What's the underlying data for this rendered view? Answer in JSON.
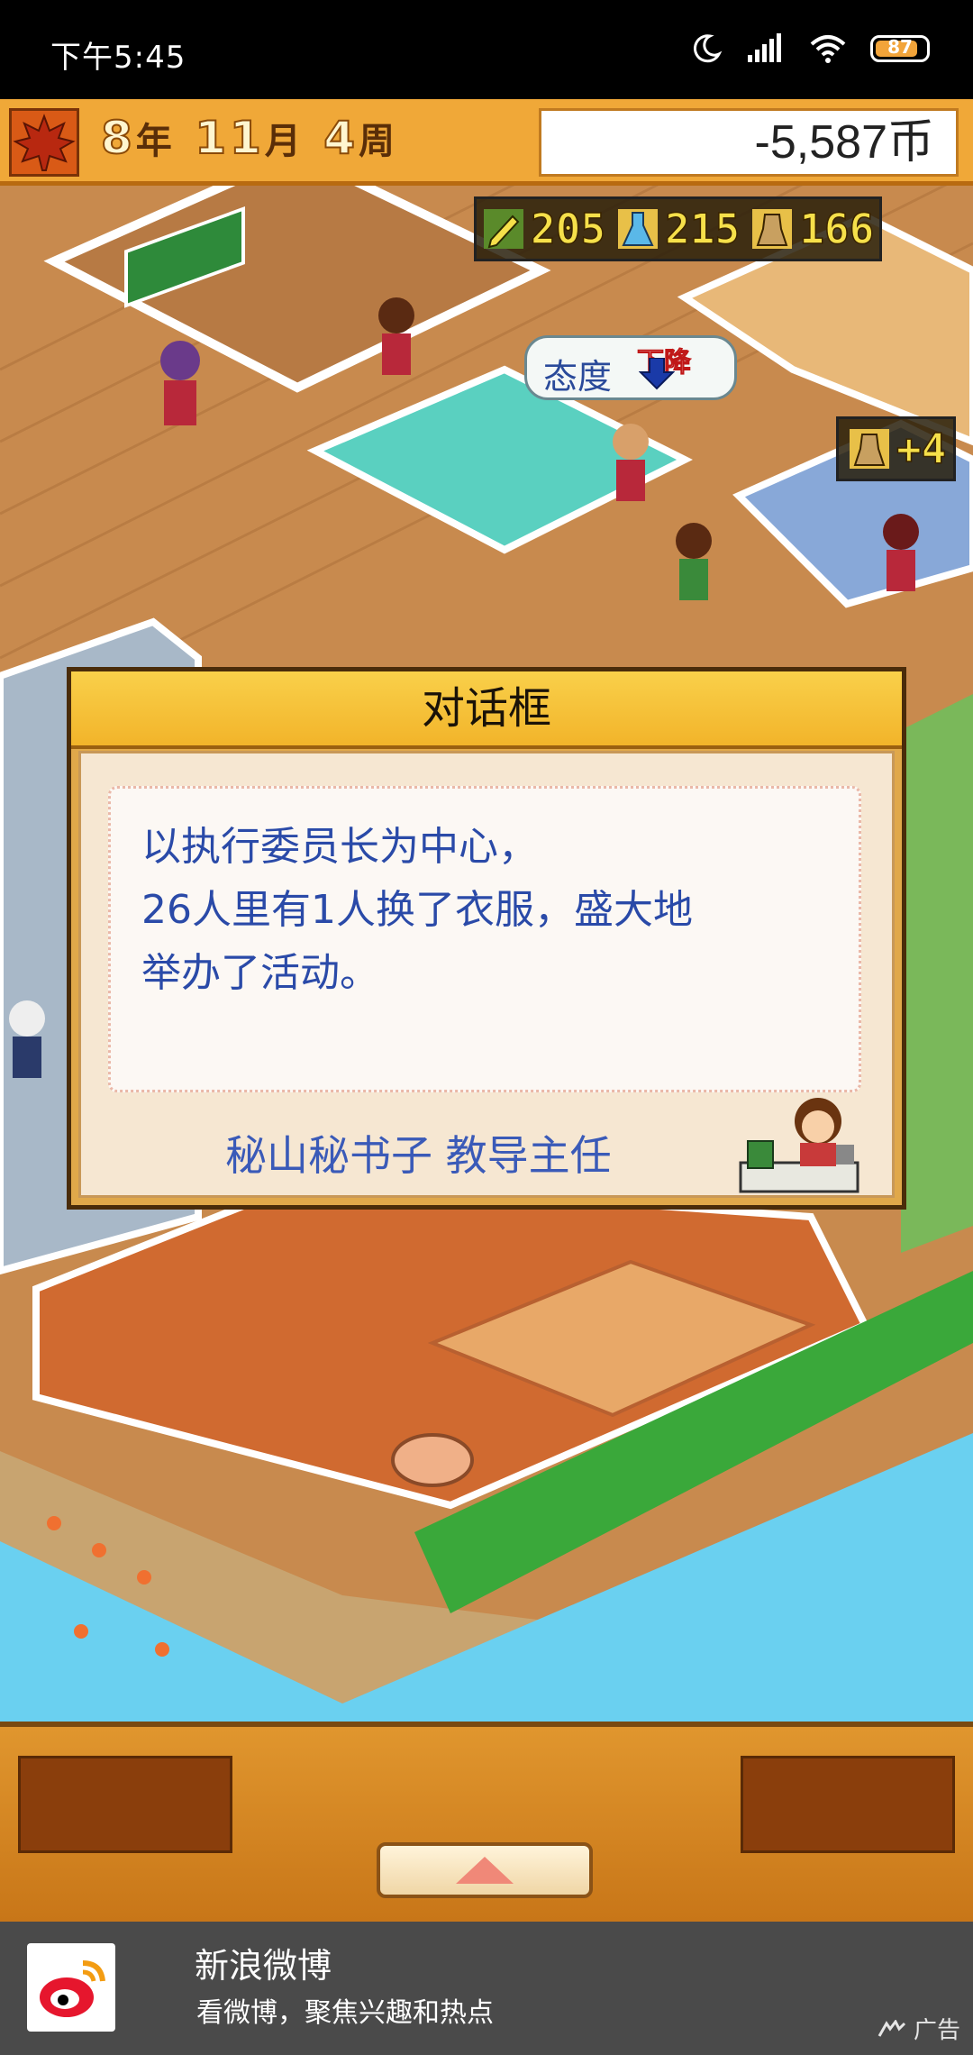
{
  "status_bar": {
    "time": "下午5:45",
    "battery_level": "87",
    "icons": [
      "moon-icon",
      "signal-icon",
      "wifi-icon",
      "battery-icon"
    ]
  },
  "hud": {
    "year": "8",
    "year_unit": "年",
    "month": "11",
    "month_unit": "月",
    "week": "4",
    "week_unit": "周",
    "money": "-5,587币",
    "season_icon": "maple-leaf-icon"
  },
  "stats": [
    {
      "icon": "pencil-icon",
      "value": "205"
    },
    {
      "icon": "flask-icon",
      "value": "215"
    },
    {
      "icon": "bell-icon",
      "value": "166"
    }
  ],
  "attitude_bubble": {
    "label": "态度",
    "change": "下降"
  },
  "gain_popup": {
    "icon": "bell-icon",
    "value": "+4"
  },
  "dialog": {
    "title": "对话框",
    "lines": [
      "以执行委员长为中心，",
      "26人里有1人换了衣服，盛大地",
      "举办了活动。"
    ],
    "speaker": "秘山秘书子 教导主任"
  },
  "ad": {
    "app_name": "新浪微博",
    "description": "看微博，聚焦兴趣和热点",
    "tag": "广告"
  },
  "colors": {
    "hud_orange": "#f0a838",
    "dialog_text": "#2a4aa8",
    "stat_yellow": "#f6e04a"
  }
}
